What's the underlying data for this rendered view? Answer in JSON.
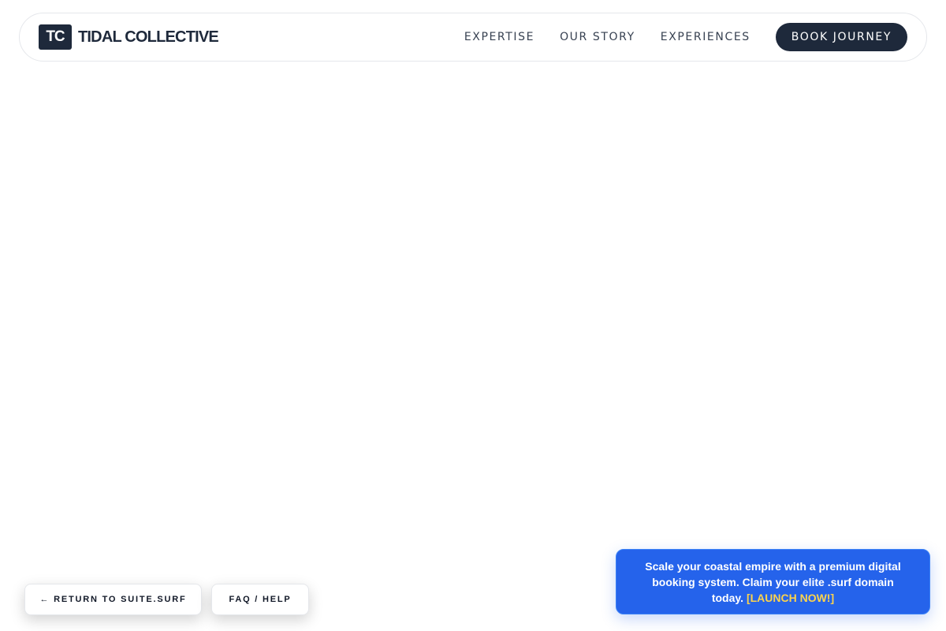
{
  "brand": {
    "logo_text": "TC",
    "name": "TIDAL COLLECTIVE"
  },
  "nav": {
    "links": [
      "EXPERTISE",
      "OUR STORY",
      "EXPERIENCES"
    ],
    "cta_label": "BOOK JOURNEY"
  },
  "floating_buttons": {
    "return_label": "← RETURN TO SUITE.SURF",
    "faq_label": "FAQ / HELP"
  },
  "promo": {
    "text": "Scale your coastal empire with a premium digital booking system. Claim your elite .surf domain today.",
    "link_label": "[LAUNCH NOW!]"
  },
  "colors": {
    "primary_dark": "#1e293b",
    "promo_blue": "#2563eb",
    "promo_link": "#fcd34d"
  }
}
